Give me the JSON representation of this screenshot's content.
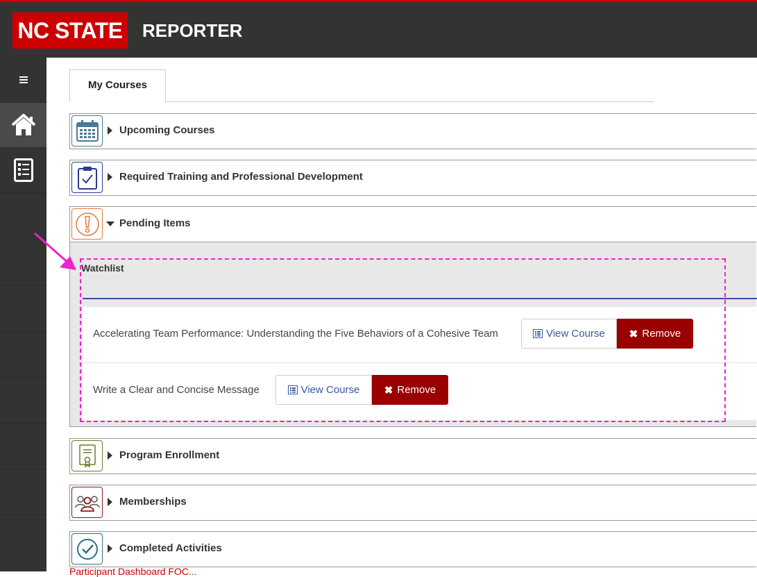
{
  "header": {
    "brand": "NC STATE",
    "title": "REPORTER"
  },
  "colors": {
    "brand_red": "#cc0000",
    "dark": "#333333",
    "remove_red": "#990000",
    "link_blue": "#3a57a3",
    "annotation_magenta": "#ee22cc"
  },
  "sidebar": {
    "items": [
      {
        "icon": "hamburger-menu-icon"
      },
      {
        "icon": "home-icon"
      },
      {
        "icon": "report-icon"
      }
    ]
  },
  "tabs": [
    {
      "label": "My Courses"
    }
  ],
  "panels": [
    {
      "title": "Upcoming Courses",
      "icon": "calendar-icon",
      "color": "#4a7a96"
    },
    {
      "title": "Required Training and Professional Development",
      "icon": "clipboard-check-icon",
      "color": "#2b3a8f"
    },
    {
      "title": "Pending Items",
      "icon": "alert-icon",
      "color": "#e07a3a"
    },
    {
      "title": "Program Enrollment",
      "icon": "certificate-icon",
      "color": "#6b7a2a"
    },
    {
      "title": "Memberships",
      "icon": "group-icon",
      "color": "#8b1a1a"
    },
    {
      "title": "Completed Activities",
      "icon": "check-circle-icon",
      "color": "#2f6f7f"
    }
  ],
  "watchlist": {
    "title": "Watchlist",
    "items": [
      {
        "name": "Accelerating Team Performance: Understanding the Five Behaviors of a Cohesive Team",
        "view_label": "View Course",
        "remove_label": "Remove"
      },
      {
        "name": "Write a Clear and Concise Message",
        "view_label": "View Course",
        "remove_label": "Remove"
      }
    ]
  },
  "footer_link": "Participant Dashboard FOC..."
}
